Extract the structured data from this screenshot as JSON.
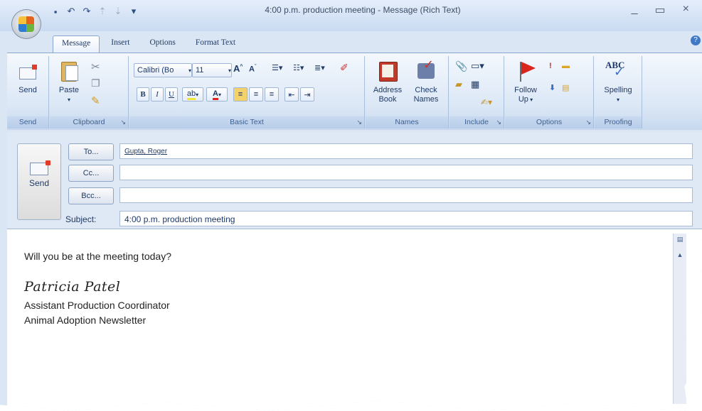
{
  "window": {
    "title": "4:00 p.m. production meeting - Message (Rich Text)",
    "controls": [
      "_",
      "▭",
      "×"
    ]
  },
  "qat": {
    "icons": [
      "save-icon",
      "undo-icon",
      "redo-icon",
      "up-icon",
      "down-icon",
      "dropdown-icon"
    ]
  },
  "tabs": [
    "Message",
    "Insert",
    "Options",
    "Format Text"
  ],
  "ribbon": {
    "groups": {
      "send": "Send",
      "clipboard": "Clipboard",
      "basic_text": "Basic Text",
      "names": "Names",
      "include": "Include",
      "options": "Options",
      "proofing": "Proofing"
    },
    "send_label": "Send",
    "paste_label": "Paste",
    "font_name": "Calibri (Bo",
    "font_size": "11",
    "address_book": [
      "Address",
      "Book"
    ],
    "check_names": [
      "Check",
      "Names"
    ],
    "follow_up": [
      "Follow",
      "Up"
    ],
    "spelling": "Spelling",
    "abc": "ABC"
  },
  "header": {
    "send_label": "Send",
    "to_button": "To...",
    "cc_button": "Cc...",
    "bcc_button": "Bcc...",
    "to_value": "Gupta, Roger",
    "cc_value": "",
    "bcc_value": "",
    "subject_label": "Subject:",
    "subject_value": "4:00 p.m. production meeting"
  },
  "body": {
    "message": "Will you be at the meeting today?",
    "signature_name": "Patricia Patel",
    "signature_title": "Assistant Production Coordinator",
    "signature_org": "Animal Adoption Newsletter"
  }
}
